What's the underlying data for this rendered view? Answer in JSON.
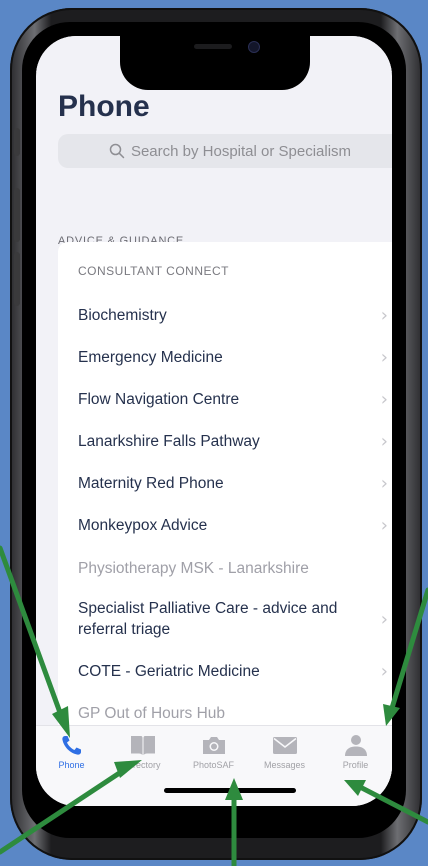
{
  "header": {
    "title": "Phone"
  },
  "search": {
    "placeholder": "Search by Hospital or Specialism"
  },
  "section": {
    "header": "ADVICE & GUIDANCE",
    "group_header": "CONSULTANT CONNECT",
    "items": [
      {
        "label": "Biochemistry",
        "enabled": true
      },
      {
        "label": "Emergency Medicine",
        "enabled": true
      },
      {
        "label": "Flow Navigation Centre",
        "enabled": true
      },
      {
        "label": "Lanarkshire Falls Pathway",
        "enabled": true
      },
      {
        "label": "Maternity Red Phone",
        "enabled": true
      },
      {
        "label": "Monkeypox Advice",
        "enabled": true
      },
      {
        "label": "Physiotherapy MSK - Lanarkshire",
        "enabled": false
      },
      {
        "label": "Specialist Palliative Care - advice and referral triage",
        "enabled": true
      },
      {
        "label": "COTE - Geriatric Medicine",
        "enabled": true
      },
      {
        "label": "GP Out of Hours Hub",
        "enabled": false
      }
    ],
    "chevron": "›"
  },
  "tabs": [
    {
      "label": "Phone",
      "icon": "phone-icon",
      "active": true
    },
    {
      "label": "Directory",
      "icon": "book-icon",
      "active": false
    },
    {
      "label": "PhotoSAF",
      "icon": "camera-icon",
      "active": false
    },
    {
      "label": "Messages",
      "icon": "envelope-icon",
      "active": false
    },
    {
      "label": "Profile",
      "icon": "person-icon",
      "active": false
    }
  ],
  "colors": {
    "accent": "#2f6fe4",
    "title": "#25314d",
    "arrow": "#2e8b3e",
    "background": "#5a87c6"
  }
}
